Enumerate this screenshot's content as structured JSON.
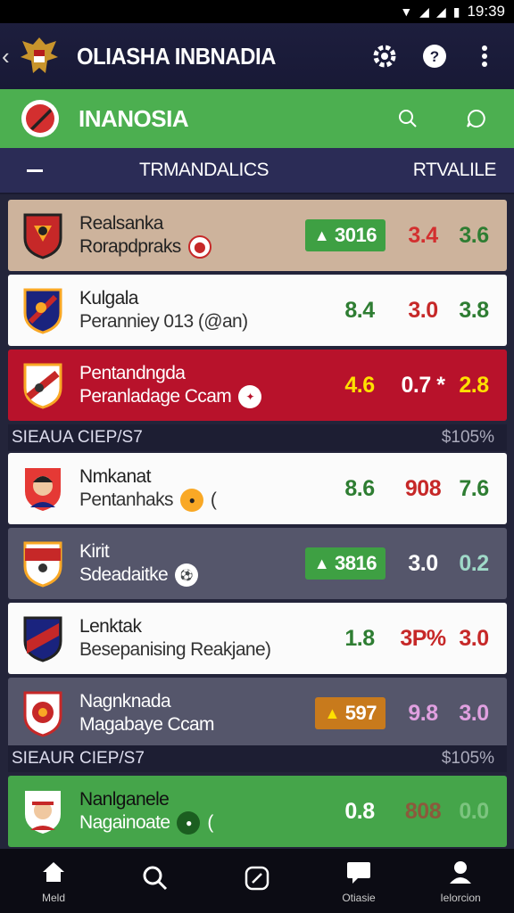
{
  "status_bar": {
    "time": "19:39"
  },
  "app_bar": {
    "title": "OLIASHA INBNADIA"
  },
  "country_bar": {
    "title": "INANOSIA"
  },
  "columns": {
    "left": "TRMANDALICS",
    "right": "RTVALILE"
  },
  "colors": {
    "green": "#4caf50",
    "red_row": "#b8122b",
    "header": "#1d1e3d",
    "odds_green": "#43a047",
    "odds_red": "#d32f2f",
    "odds_yellow": "#ffe000"
  },
  "rows": [
    {
      "name": "Realsanka",
      "sub": "Rorapdpraks",
      "pill": "3016",
      "o1": "",
      "o2": "3.4",
      "o3": "3.6",
      "style": "tan"
    },
    {
      "name": "Kulgala",
      "sub": "Peranniey 013 (@an)",
      "pill": "",
      "o1": "8.4",
      "o2": "3.0",
      "o3": "3.8",
      "style": "light"
    },
    {
      "name": "Pentandngda",
      "sub": "Peranladage Ccam",
      "pill": "",
      "o1": "4.6",
      "o2": "0.7 *",
      "o3": "2.8",
      "style": "red"
    },
    {
      "name": "Nmkanat",
      "sub": "Pentanhaks",
      "pill": "",
      "o1": "8.6",
      "o2": "908",
      "o3": "7.6",
      "style": "light"
    },
    {
      "name": "Kirit",
      "sub": "Sdeadaitke",
      "pill": "3816",
      "o1": "",
      "o2": "3.0",
      "o3": "0.2",
      "style": "grey"
    },
    {
      "name": "Lenktak",
      "sub": "Besepanising Reakjane)",
      "pill": "",
      "o1": "1.8",
      "o2": "3P%",
      "o3": "3.0",
      "style": "light"
    },
    {
      "name": "Nagnknada",
      "sub": "Magabaye Ccam",
      "pill": "597",
      "o1": "",
      "o2": "9.8",
      "o3": "3.0",
      "style": "grey"
    },
    {
      "name": "Nanlganele",
      "sub": "Nagainoate",
      "pill": "",
      "o1": "0.8",
      "o2": "808",
      "o3": "0.0",
      "style": "green"
    }
  ],
  "sections": [
    {
      "left": "SIEAUA CIEP/S7",
      "right": "$105%"
    },
    {
      "left": "SIEAUR CIEP/S7",
      "right": "$105%"
    }
  ],
  "bottom_nav": [
    {
      "label": "Meld",
      "icon": "home-icon"
    },
    {
      "label": "",
      "icon": "search-icon"
    },
    {
      "label": "",
      "icon": "compass-icon"
    },
    {
      "label": "Otiasie",
      "icon": "chat-icon"
    },
    {
      "label": "Ielorcion",
      "icon": "profile-icon"
    }
  ]
}
